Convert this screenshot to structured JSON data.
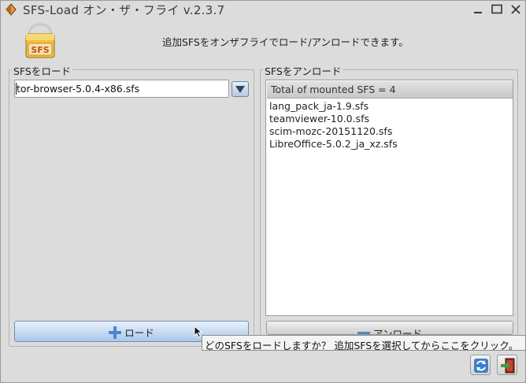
{
  "window": {
    "title": "SFS-Load オン・ザ・フライ v.2.3.7"
  },
  "header": {
    "logo_text": "SFS",
    "description": "追加SFSをオンザフライでロード/アンロードできます。"
  },
  "load_panel": {
    "title": "SFSをロード",
    "combo_value": "tor-browser-5.0.4-x86.sfs",
    "button_label": "ロード"
  },
  "unload_panel": {
    "title": "SFSをアンロード",
    "list_header": "Total of mounted SFS = 4",
    "items": [
      "lang_pack_ja-1.9.sfs",
      "teamviewer-10.0.sfs",
      "scim-mozc-20151120.sfs",
      "LibreOffice-5.0.2_ja_xz.sfs"
    ],
    "button_label": "アンロード"
  },
  "tooltip": {
    "text": "どのSFSをロードしますか？ 追加SFSを選択してからここをクリック。"
  },
  "icons": {
    "app": "sfs-package-icon",
    "minimize": "minimize-icon",
    "maximize": "maximize-icon",
    "close": "close-icon",
    "refresh": "refresh-icon",
    "quit": "exit-icon"
  },
  "colors": {
    "accent": "#4f86c9",
    "window_bg": "#dcdcdc",
    "button_blue": "#a9c7ea"
  }
}
